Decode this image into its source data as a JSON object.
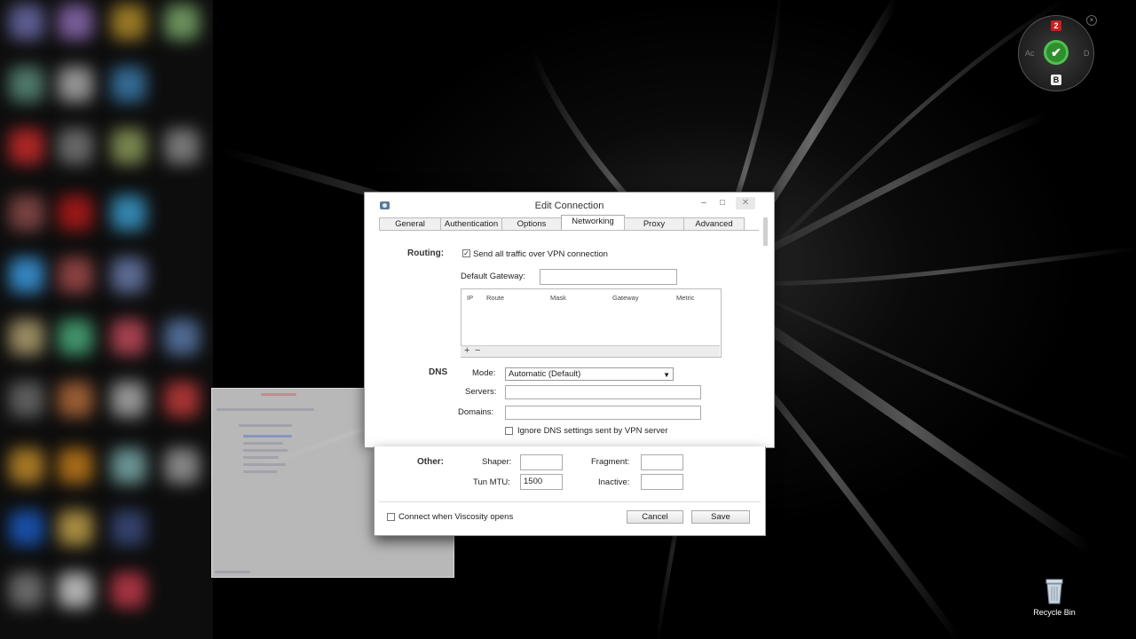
{
  "desktop": {
    "recycle_bin_label": "Recycle Bin",
    "gadget": {
      "badge_top": "2",
      "badge_bottom": "B",
      "side_left": "Ac",
      "side_right": "D"
    }
  },
  "dialog": {
    "title": "Edit Connection",
    "window_buttons": {
      "minimize": "–",
      "maximize": "□",
      "close": "✕"
    },
    "tabs": [
      {
        "label": "General"
      },
      {
        "label": "Authentication"
      },
      {
        "label": "Options"
      },
      {
        "label": "Networking"
      },
      {
        "label": "Proxy"
      },
      {
        "label": "Advanced"
      }
    ],
    "active_tab": "Networking",
    "routing": {
      "section_label": "Routing:",
      "send_all_traffic_label": "Send all traffic over VPN connection",
      "send_all_traffic_checked": true,
      "default_gateway_label": "Default Gateway:",
      "default_gateway_value": "",
      "route_columns": [
        "IP",
        "Route",
        "Mask",
        "Gateway",
        "Metric"
      ],
      "add_button": "+",
      "remove_button": "−"
    },
    "dns": {
      "section_label": "DNS",
      "mode_label": "Mode:",
      "mode_value": "Automatic (Default)",
      "servers_label": "Servers:",
      "servers_value": "",
      "domains_label": "Domains:",
      "domains_value": "",
      "ignore_label": "Ignore DNS settings sent by VPN server",
      "ignore_checked": false
    },
    "other": {
      "section_label": "Other:",
      "shaper_label": "Shaper:",
      "shaper_value": "",
      "fragment_label": "Fragment:",
      "fragment_value": "",
      "tun_mtu_label": "Tun MTU:",
      "tun_mtu_value": "1500",
      "inactive_label": "Inactive:",
      "inactive_value": ""
    },
    "footer": {
      "connect_label": "Connect when Viscosity opens",
      "connect_checked": false,
      "cancel_label": "Cancel",
      "save_label": "Save"
    }
  }
}
